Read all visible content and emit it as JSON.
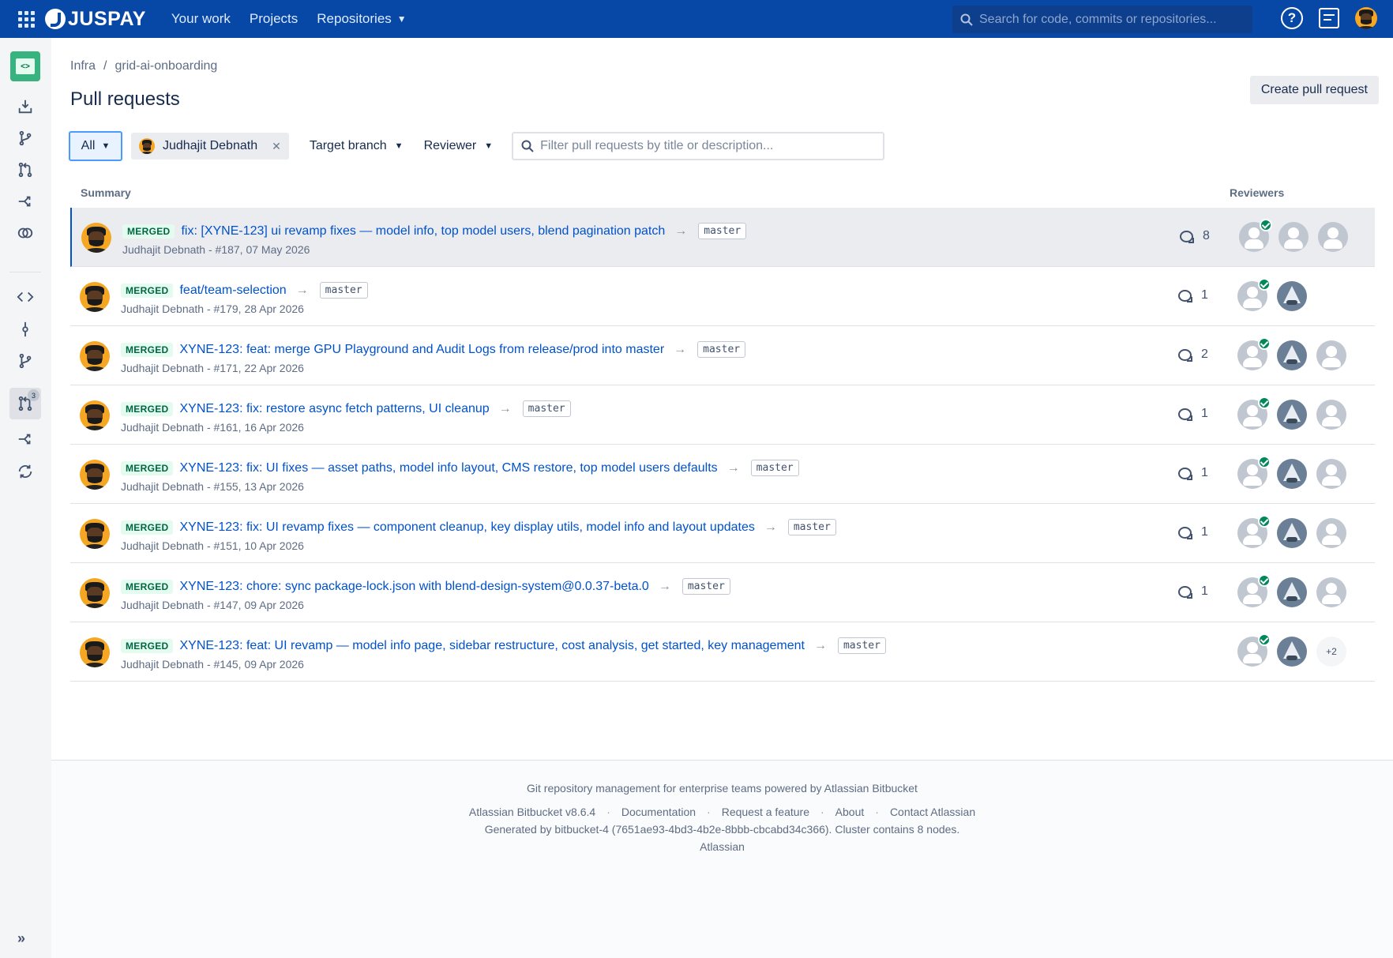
{
  "header": {
    "brand": "JUSPAY",
    "nav": [
      "Your work",
      "Projects",
      "Repositories"
    ],
    "search_placeholder": "Search for code, commits or repositories..."
  },
  "sidebar": {
    "pr_badge": "3"
  },
  "breadcrumb": {
    "project": "Infra",
    "separator": "/",
    "repo": "grid-ai-onboarding"
  },
  "page": {
    "title": "Pull requests",
    "create_label": "Create pull request"
  },
  "filters": {
    "state": "All",
    "author_chip": "Judhajit Debnath",
    "target_branch": "Target branch",
    "reviewer": "Reviewer",
    "search_placeholder": "Filter pull requests by title or description..."
  },
  "columns": {
    "summary": "Summary",
    "reviewers": "Reviewers"
  },
  "pull_requests": [
    {
      "state": "MERGED",
      "title": "fix: [XYNE-123] ui revamp fixes — model info, top model users, blend pagination patch",
      "branch": "master",
      "meta": "Judhajit Debnath - #187, 07 May 2026",
      "comments": "8"
    },
    {
      "state": "MERGED",
      "title": "feat/team-selection",
      "branch": "master",
      "meta": "Judhajit Debnath - #179, 28 Apr 2026",
      "comments": "1"
    },
    {
      "state": "MERGED",
      "title": "XYNE-123: feat: merge GPU Playground and Audit Logs from release/prod into master",
      "branch": "master",
      "meta": "Judhajit Debnath - #171, 22 Apr 2026",
      "comments": "2"
    },
    {
      "state": "MERGED",
      "title": "XYNE-123: fix: restore async fetch patterns, UI cleanup",
      "branch": "master",
      "meta": "Judhajit Debnath - #161, 16 Apr 2026",
      "comments": "1"
    },
    {
      "state": "MERGED",
      "title": "XYNE-123: fix: UI fixes — asset paths, model info layout, CMS restore, top model users defaults",
      "branch": "master",
      "meta": "Judhajit Debnath - #155, 13 Apr 2026",
      "comments": "1"
    },
    {
      "state": "MERGED",
      "title": "XYNE-123: fix: UI revamp fixes — component cleanup, key display utils, model info and layout updates",
      "branch": "master",
      "meta": "Judhajit Debnath - #151, 10 Apr 2026",
      "comments": "1"
    },
    {
      "state": "MERGED",
      "title": "XYNE-123: chore: sync package-lock.json with blend-design-system@0.0.37-beta.0",
      "branch": "master",
      "meta": "Judhajit Debnath - #147, 09 Apr 2026",
      "comments": "1"
    },
    {
      "state": "MERGED",
      "title": "XYNE-123: feat: UI revamp — model info page, sidebar restructure, cost analysis, get started, key management",
      "branch": "master",
      "meta": "Judhajit Debnath - #145, 09 Apr 2026",
      "comments": "",
      "more_reviewers": "+2"
    }
  ],
  "footer": {
    "tagline": "Git repository management for enterprise teams powered by Atlassian Bitbucket",
    "links": [
      "Atlassian Bitbucket v8.6.4",
      "Documentation",
      "Request a feature",
      "About",
      "Contact Atlassian"
    ],
    "link_separator": "·",
    "generated": "Generated by bitbucket-4 (7651ae93-4bd3-4b2e-8bbb-cbcabd34c366). Cluster contains 8 nodes.",
    "company": "Atlassian"
  }
}
